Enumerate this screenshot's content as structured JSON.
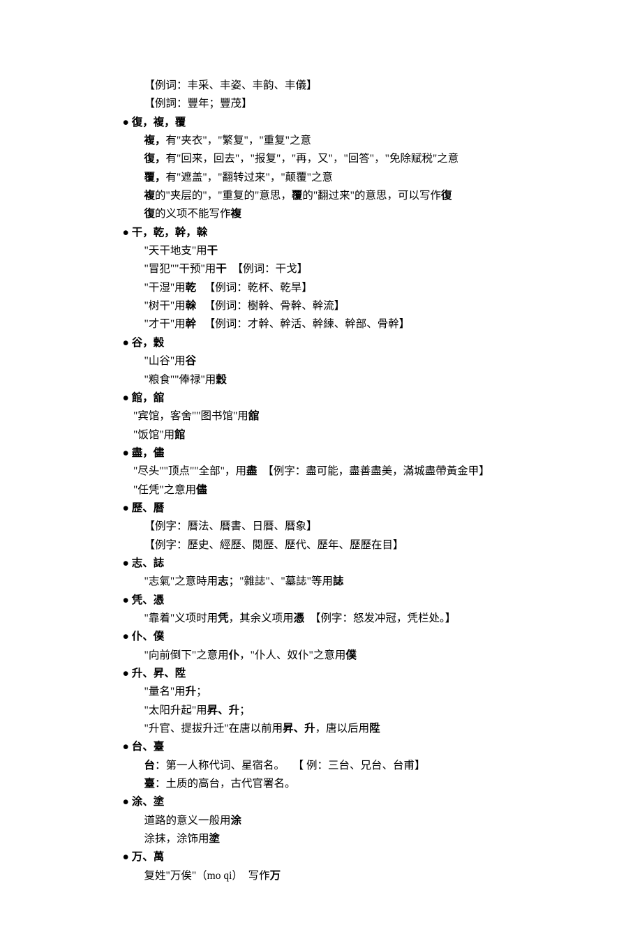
{
  "lines": [
    {
      "cls": "sub",
      "html": "【例词：丰采、丰姿、丰韵、丰儀】"
    },
    {
      "cls": "sub",
      "html": "【例詞：豐年；豐茂】"
    },
    {
      "cls": "head-indent",
      "html": "● <span class='b'>復，複，覆</span>"
    },
    {
      "cls": "sub",
      "html": "<span class='b'>複，</span>有\"夹衣\"，\"繁复\"，\"重复\"之意"
    },
    {
      "cls": "sub",
      "html": "<span class='b'>復，</span>有\"回来，回去\"，\"报复\"，\"再，又\"，\"回答\"，\"免除赋税\"之意"
    },
    {
      "cls": "sub",
      "html": "<span class='b'>覆，</span>有\"遮盖\"，\"翻转过来\"，\"颠覆\"之意"
    },
    {
      "cls": "sub",
      "html": "<span class='b'>複</span>的\"夹层的\"，\"重复的\"意思，<span class='b'>覆</span>的\"翻过来\"的意思，可以写作<span class='b'>復</span>"
    },
    {
      "cls": "sub",
      "html": "<span class='b'>復</span>的义项不能写作<span class='b'>複</span>"
    },
    {
      "cls": "head-indent",
      "html": "● <span class='b'>干，乾，幹，榦</span>"
    },
    {
      "cls": "sub",
      "html": "\"天干地支\"用<span class='b'>干</span>"
    },
    {
      "cls": "sub",
      "html": "\"冒犯\"\"干预\"用<span class='b'>干</span>&nbsp;&nbsp;【例词：干戈】"
    },
    {
      "cls": "sub",
      "html": "\"干湿\"用<span class='b'>乾</span>&nbsp;&nbsp;&nbsp;【例词：乾杯、乾旱】"
    },
    {
      "cls": "sub",
      "html": "\"树干\"用<span class='b'>榦</span>&nbsp;&nbsp;&nbsp;【例词：樹幹、骨幹、幹流】"
    },
    {
      "cls": "sub",
      "html": "\"才干\"用<span class='b'>幹</span>&nbsp;&nbsp;&nbsp;【例词：才幹、幹活、幹練、幹部、骨幹】"
    },
    {
      "cls": "head-indent",
      "html": "● <span class='b'>谷，穀</span>"
    },
    {
      "cls": "sub",
      "html": "\"山谷\"用<span class='b'>谷</span>"
    },
    {
      "cls": "sub",
      "html": "\"粮食\"\"俸禄\"用<span class='b'>穀</span>"
    },
    {
      "cls": "head-indent",
      "html": "● <span class='b'>館，舘</span>"
    },
    {
      "cls": "sub2",
      "html": "\"宾馆，客舍\"\"图书馆\"用<span class='b'>舘</span>"
    },
    {
      "cls": "sub2",
      "html": "\"饭馆\"用<span class='b'>館</span>"
    },
    {
      "cls": "head-indent",
      "html": "● <span class='b'>盡，儘</span>"
    },
    {
      "cls": "sub2",
      "html": "\"尽头\"\"顶点\"\"全部\"，用<span class='b'>盡</span>&nbsp;&nbsp;【例字：盡可能，盡善盡美，滿城盡帶黃金甲】"
    },
    {
      "cls": "sub2",
      "html": "\"任凭\"之意用<span class='b'>儘</span>"
    },
    {
      "cls": "head-indent",
      "html": "● <span class='b'>歷、曆</span>"
    },
    {
      "cls": "sub",
      "html": "【例字：曆法、曆書、日曆、曆象】"
    },
    {
      "cls": "sub",
      "html": "【例字：歷史、經歷、閱歷、歷代、歷年、歷歷在目】"
    },
    {
      "cls": "head-indent",
      "html": "● <span class='b'>志、誌</span>"
    },
    {
      "cls": "sub",
      "html": "\"志氣\"之意時用<span class='b'>志</span>；\"雜誌\"、\"墓誌\"等用<span class='b'>誌</span>"
    },
    {
      "cls": "head-indent",
      "html": "● <span class='b'>凭、憑</span>"
    },
    {
      "cls": "sub",
      "html": "\"靠着\"义项时用<span class='b'>凭</span>，其余义项用<span class='b'>憑</span>&nbsp;&nbsp;【例字：怒发冲冠，凭栏处。】"
    },
    {
      "cls": "head-indent",
      "html": "● <span class='b'>仆、僕</span>"
    },
    {
      "cls": "sub",
      "html": "\"向前倒下\"之意用<span class='b'>仆</span>，\"仆人、奴仆\"之意用<span class='b'>僕</span>"
    },
    {
      "cls": "head-indent",
      "html": "● <span class='b'>升、昇、陞</span>"
    },
    {
      "cls": "sub",
      "html": "\"量名\"用<span class='b'>升</span>；"
    },
    {
      "cls": "sub",
      "html": "\"太阳升起\"用<span class='b'>昇、升</span>；"
    },
    {
      "cls": "sub",
      "html": "\"升官、提拔升迁\"在唐以前用<span class='b'>昇、升</span>，唐以后用<span class='b'>陞</span>"
    },
    {
      "cls": "head-indent",
      "html": "● <span class='b'>台、臺</span>"
    },
    {
      "cls": "sub",
      "html": "<span class='b'>台</span>：第一人称代词、星宿名。&nbsp;&nbsp;&nbsp;【 例：三台、兄台、台甫】"
    },
    {
      "cls": "sub",
      "html": "<span class='b'>臺</span>：土质的高台，古代官署名。"
    },
    {
      "cls": "head-indent",
      "html": "● <span class='b'>涂、塗</span>"
    },
    {
      "cls": "sub",
      "html": "道路的意义一般用<span class='b'>涂</span>"
    },
    {
      "cls": "sub",
      "html": "涂抹，涂饰用<span class='b'>塗</span>"
    },
    {
      "cls": "head-indent",
      "html": "● <span class='b'>万、萬</span>"
    },
    {
      "cls": "sub",
      "html": "复姓\"万俟\"（mo qi）&nbsp;&nbsp;写作<span class='b'>万</span>"
    }
  ]
}
